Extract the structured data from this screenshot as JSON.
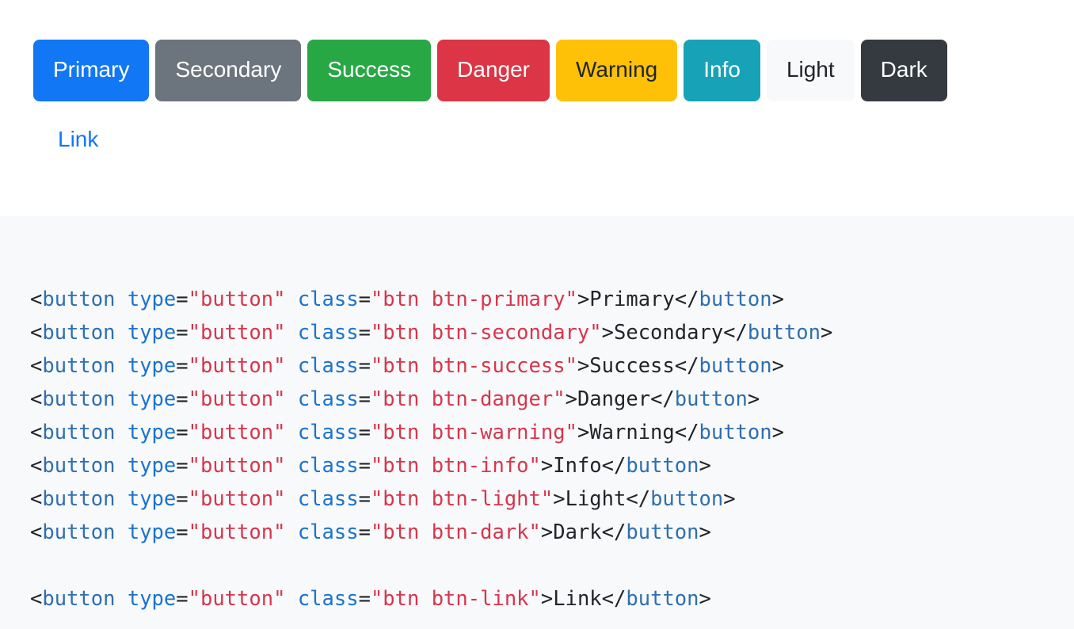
{
  "preview": {
    "buttons": [
      {
        "label": "Primary",
        "variant": "btn-primary",
        "bg": "#1177f5",
        "fg": "#ffffff",
        "border": "#1177f5"
      },
      {
        "label": "Secondary",
        "variant": "btn-secondary",
        "bg": "#6c757d",
        "fg": "#ffffff",
        "border": "#6c757d"
      },
      {
        "label": "Success",
        "variant": "btn-success",
        "bg": "#28a745",
        "fg": "#ffffff",
        "border": "#28a745"
      },
      {
        "label": "Danger",
        "variant": "btn-danger",
        "bg": "#dc3545",
        "fg": "#ffffff",
        "border": "#dc3545"
      },
      {
        "label": "Warning",
        "variant": "btn-warning",
        "bg": "#ffc107",
        "fg": "#212529",
        "border": "#ffc107"
      },
      {
        "label": "Info",
        "variant": "btn-info",
        "bg": "#17a2b8",
        "fg": "#ffffff",
        "border": "#17a2b8"
      },
      {
        "label": "Light",
        "variant": "btn-light",
        "bg": "#f8f9fa",
        "fg": "#212529",
        "border": "#f8f9fa"
      },
      {
        "label": "Dark",
        "variant": "btn-dark",
        "bg": "#343a40",
        "fg": "#ffffff",
        "border": "#343a40"
      }
    ],
    "link_button": {
      "label": "Link",
      "variant": "btn-link",
      "bg": "transparent",
      "fg": "#1177f5",
      "border": "transparent"
    }
  },
  "code": {
    "language": "html",
    "background": "#f8f9fa",
    "colors": {
      "tag": "#2f6fb0",
      "attribute": "#1a73cf",
      "string": "#d6364d",
      "punctuation": "#212529",
      "text": "#212529"
    },
    "lines": [
      {
        "tokens": [
          {
            "t": "punc",
            "v": "<"
          },
          {
            "t": "tag",
            "v": "button"
          },
          {
            "t": "punc",
            "v": " "
          },
          {
            "t": "attr",
            "v": "type"
          },
          {
            "t": "punc",
            "v": "="
          },
          {
            "t": "str",
            "v": "\"button\""
          },
          {
            "t": "punc",
            "v": " "
          },
          {
            "t": "attr",
            "v": "class"
          },
          {
            "t": "punc",
            "v": "="
          },
          {
            "t": "str",
            "v": "\"btn btn-primary\""
          },
          {
            "t": "punc",
            "v": ">"
          },
          {
            "t": "text",
            "v": "Primary"
          },
          {
            "t": "punc",
            "v": "</"
          },
          {
            "t": "tag",
            "v": "button"
          },
          {
            "t": "punc",
            "v": ">"
          }
        ]
      },
      {
        "tokens": [
          {
            "t": "punc",
            "v": "<"
          },
          {
            "t": "tag",
            "v": "button"
          },
          {
            "t": "punc",
            "v": " "
          },
          {
            "t": "attr",
            "v": "type"
          },
          {
            "t": "punc",
            "v": "="
          },
          {
            "t": "str",
            "v": "\"button\""
          },
          {
            "t": "punc",
            "v": " "
          },
          {
            "t": "attr",
            "v": "class"
          },
          {
            "t": "punc",
            "v": "="
          },
          {
            "t": "str",
            "v": "\"btn btn-secondary\""
          },
          {
            "t": "punc",
            "v": ">"
          },
          {
            "t": "text",
            "v": "Secondary"
          },
          {
            "t": "punc",
            "v": "</"
          },
          {
            "t": "tag",
            "v": "button"
          },
          {
            "t": "punc",
            "v": ">"
          }
        ]
      },
      {
        "tokens": [
          {
            "t": "punc",
            "v": "<"
          },
          {
            "t": "tag",
            "v": "button"
          },
          {
            "t": "punc",
            "v": " "
          },
          {
            "t": "attr",
            "v": "type"
          },
          {
            "t": "punc",
            "v": "="
          },
          {
            "t": "str",
            "v": "\"button\""
          },
          {
            "t": "punc",
            "v": " "
          },
          {
            "t": "attr",
            "v": "class"
          },
          {
            "t": "punc",
            "v": "="
          },
          {
            "t": "str",
            "v": "\"btn btn-success\""
          },
          {
            "t": "punc",
            "v": ">"
          },
          {
            "t": "text",
            "v": "Success"
          },
          {
            "t": "punc",
            "v": "</"
          },
          {
            "t": "tag",
            "v": "button"
          },
          {
            "t": "punc",
            "v": ">"
          }
        ]
      },
      {
        "tokens": [
          {
            "t": "punc",
            "v": "<"
          },
          {
            "t": "tag",
            "v": "button"
          },
          {
            "t": "punc",
            "v": " "
          },
          {
            "t": "attr",
            "v": "type"
          },
          {
            "t": "punc",
            "v": "="
          },
          {
            "t": "str",
            "v": "\"button\""
          },
          {
            "t": "punc",
            "v": " "
          },
          {
            "t": "attr",
            "v": "class"
          },
          {
            "t": "punc",
            "v": "="
          },
          {
            "t": "str",
            "v": "\"btn btn-danger\""
          },
          {
            "t": "punc",
            "v": ">"
          },
          {
            "t": "text",
            "v": "Danger"
          },
          {
            "t": "punc",
            "v": "</"
          },
          {
            "t": "tag",
            "v": "button"
          },
          {
            "t": "punc",
            "v": ">"
          }
        ]
      },
      {
        "tokens": [
          {
            "t": "punc",
            "v": "<"
          },
          {
            "t": "tag",
            "v": "button"
          },
          {
            "t": "punc",
            "v": " "
          },
          {
            "t": "attr",
            "v": "type"
          },
          {
            "t": "punc",
            "v": "="
          },
          {
            "t": "str",
            "v": "\"button\""
          },
          {
            "t": "punc",
            "v": " "
          },
          {
            "t": "attr",
            "v": "class"
          },
          {
            "t": "punc",
            "v": "="
          },
          {
            "t": "str",
            "v": "\"btn btn-warning\""
          },
          {
            "t": "punc",
            "v": ">"
          },
          {
            "t": "text",
            "v": "Warning"
          },
          {
            "t": "punc",
            "v": "</"
          },
          {
            "t": "tag",
            "v": "button"
          },
          {
            "t": "punc",
            "v": ">"
          }
        ]
      },
      {
        "tokens": [
          {
            "t": "punc",
            "v": "<"
          },
          {
            "t": "tag",
            "v": "button"
          },
          {
            "t": "punc",
            "v": " "
          },
          {
            "t": "attr",
            "v": "type"
          },
          {
            "t": "punc",
            "v": "="
          },
          {
            "t": "str",
            "v": "\"button\""
          },
          {
            "t": "punc",
            "v": " "
          },
          {
            "t": "attr",
            "v": "class"
          },
          {
            "t": "punc",
            "v": "="
          },
          {
            "t": "str",
            "v": "\"btn btn-info\""
          },
          {
            "t": "punc",
            "v": ">"
          },
          {
            "t": "text",
            "v": "Info"
          },
          {
            "t": "punc",
            "v": "</"
          },
          {
            "t": "tag",
            "v": "button"
          },
          {
            "t": "punc",
            "v": ">"
          }
        ]
      },
      {
        "tokens": [
          {
            "t": "punc",
            "v": "<"
          },
          {
            "t": "tag",
            "v": "button"
          },
          {
            "t": "punc",
            "v": " "
          },
          {
            "t": "attr",
            "v": "type"
          },
          {
            "t": "punc",
            "v": "="
          },
          {
            "t": "str",
            "v": "\"button\""
          },
          {
            "t": "punc",
            "v": " "
          },
          {
            "t": "attr",
            "v": "class"
          },
          {
            "t": "punc",
            "v": "="
          },
          {
            "t": "str",
            "v": "\"btn btn-light\""
          },
          {
            "t": "punc",
            "v": ">"
          },
          {
            "t": "text",
            "v": "Light"
          },
          {
            "t": "punc",
            "v": "</"
          },
          {
            "t": "tag",
            "v": "button"
          },
          {
            "t": "punc",
            "v": ">"
          }
        ]
      },
      {
        "tokens": [
          {
            "t": "punc",
            "v": "<"
          },
          {
            "t": "tag",
            "v": "button"
          },
          {
            "t": "punc",
            "v": " "
          },
          {
            "t": "attr",
            "v": "type"
          },
          {
            "t": "punc",
            "v": "="
          },
          {
            "t": "str",
            "v": "\"button\""
          },
          {
            "t": "punc",
            "v": " "
          },
          {
            "t": "attr",
            "v": "class"
          },
          {
            "t": "punc",
            "v": "="
          },
          {
            "t": "str",
            "v": "\"btn btn-dark\""
          },
          {
            "t": "punc",
            "v": ">"
          },
          {
            "t": "text",
            "v": "Dark"
          },
          {
            "t": "punc",
            "v": "</"
          },
          {
            "t": "tag",
            "v": "button"
          },
          {
            "t": "punc",
            "v": ">"
          }
        ]
      },
      {
        "tokens": []
      },
      {
        "tokens": [
          {
            "t": "punc",
            "v": "<"
          },
          {
            "t": "tag",
            "v": "button"
          },
          {
            "t": "punc",
            "v": " "
          },
          {
            "t": "attr",
            "v": "type"
          },
          {
            "t": "punc",
            "v": "="
          },
          {
            "t": "str",
            "v": "\"button\""
          },
          {
            "t": "punc",
            "v": " "
          },
          {
            "t": "attr",
            "v": "class"
          },
          {
            "t": "punc",
            "v": "="
          },
          {
            "t": "str",
            "v": "\"btn btn-link\""
          },
          {
            "t": "punc",
            "v": ">"
          },
          {
            "t": "text",
            "v": "Link"
          },
          {
            "t": "punc",
            "v": "</"
          },
          {
            "t": "tag",
            "v": "button"
          },
          {
            "t": "punc",
            "v": ">"
          }
        ]
      }
    ]
  }
}
